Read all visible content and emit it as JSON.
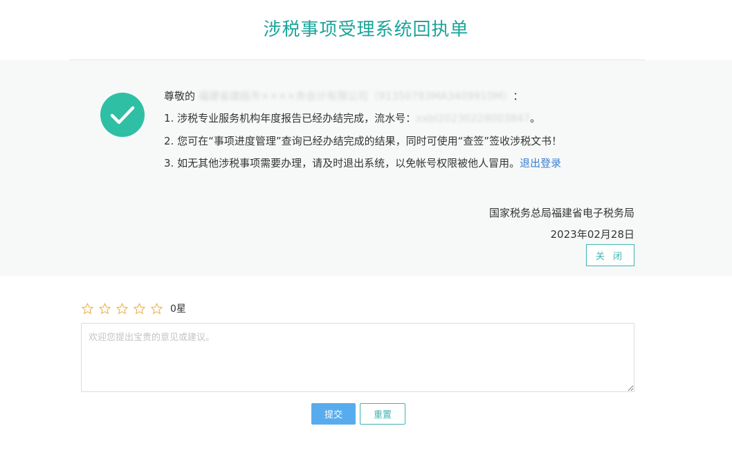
{
  "page": {
    "title": "涉税事项受理系统回执单"
  },
  "receipt": {
    "greeting_prefix": "尊敬的",
    "greeting_redacted": "福建省建瓯市××××务会计有限公司（91350783MA3409910M）",
    "greeting_suffix": "：",
    "line1_prefix": "1. 涉税专业服务机构年度报告已经办结完成，流水号：",
    "line1_redacted": "xxbl20230228003847",
    "line1_suffix": "。",
    "line2": "2. 您可在“事项进度管理”查询已经办结完成的结果，同时可使用“查签”签收涉税文书！",
    "line3_prefix": "3. 如无其他涉税事项需要办理，请及时退出系统，以免帐号权限被他人冒用。",
    "logout_link": "退出登录",
    "issuer": "国家税务总局福建省电子税务局",
    "date": "2023年02月28日",
    "close_label": "关 闭"
  },
  "feedback": {
    "rating": 0,
    "rating_max": 5,
    "rating_label": "0星",
    "placeholder": "欢迎您提出宝贵的意见或建议。",
    "value": "",
    "submit_label": "提交",
    "reset_label": "重置"
  },
  "colors": {
    "accent": "#1aa59a",
    "check": "#2fbfa5",
    "star": "#f0b04a",
    "link": "#3a7fd2",
    "submit": "#58acee",
    "outline_button": "#3db3b0"
  },
  "icons": {
    "success": "checkmark-circle-icon",
    "star": "star-outline-icon"
  }
}
